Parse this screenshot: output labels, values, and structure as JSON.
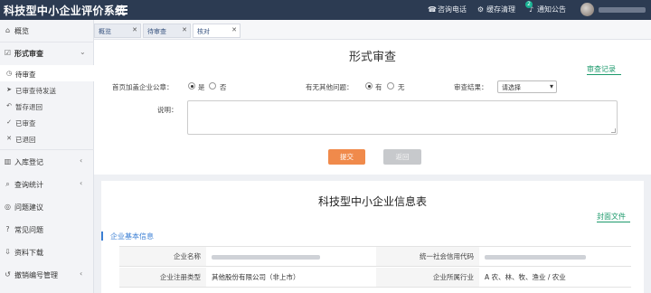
{
  "header": {
    "app_title": "科技型中小企业评价系统",
    "consult_label": "咨询电话",
    "cache_label": "缓存清理",
    "notice_label": "通知公告",
    "notice_count": "2"
  },
  "sidebar": {
    "overview": "概览",
    "formal_review": "形式审查",
    "sub_items": [
      "待审查",
      "已审查待发送",
      "暂存退回",
      "已审查",
      "已退回"
    ],
    "storage": "入库登记",
    "stats": "查询统计",
    "suggest": "问题建议",
    "faq": "常见问题",
    "download": "资料下载",
    "revoke": "撤销编号管理"
  },
  "tabs": [
    {
      "label": "概览"
    },
    {
      "label": "待审查"
    },
    {
      "label": "核对"
    }
  ],
  "form": {
    "title": "形式审查",
    "review_record_link": "审查记录",
    "seal_label": "首页加盖企业公章：",
    "seal_yes": "是",
    "seal_no": "否",
    "other_issue_label": "有无其他问题：",
    "other_yes": "有",
    "other_no": "无",
    "result_label": "审查结果：",
    "result_select": "请选择",
    "note_label": "说明：",
    "note_value": "",
    "submit": "提交",
    "cancel": "返回"
  },
  "info": {
    "title": "科技型中小企业信息表",
    "cover_link": "封面文件",
    "section_head": "企业基本信息",
    "rows": [
      {
        "l1": "企业名称",
        "v1": "",
        "l2": "统一社会信用代码",
        "v2": ""
      },
      {
        "l1": "企业注册类型",
        "v1": "其他股份有限公司（非上市）",
        "l2": "企业所属行业",
        "v2": "A 农、林、牧、渔业 / 农业"
      }
    ]
  },
  "colors": {
    "topbar": "#2c3b52",
    "accent_green": "#1d9a6c",
    "submit_orange": "#f08a4b",
    "section_blue": "#3b7fd4"
  }
}
